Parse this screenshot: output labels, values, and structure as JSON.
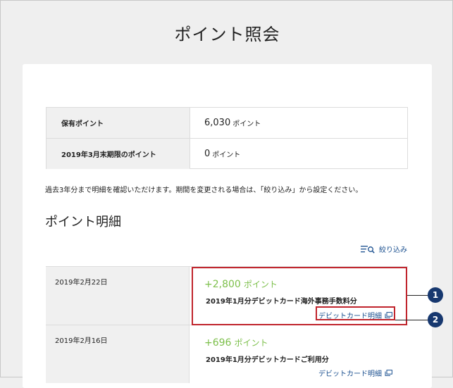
{
  "page": {
    "title": "ポイント照会"
  },
  "summary": {
    "rows": [
      {
        "label": "保有ポイント",
        "value": "6,030",
        "unit": "ポイント"
      },
      {
        "label": "2019年3月末期限のポイント",
        "value": "0",
        "unit": "ポイント"
      }
    ]
  },
  "note": "過去3年分まで明細を確認いただけます。期間を変更される場合は、「絞り込み」から設定ください。",
  "detail": {
    "title": "ポイント明細",
    "filter_label": "絞り込み",
    "rows": [
      {
        "date": "2019年2月22日",
        "points": "+2,800",
        "unit": "ポイント",
        "description": "2019年1月分デビットカード海外事務手数料分",
        "link": "デビットカード明細"
      },
      {
        "date": "2019年2月16日",
        "points": "+696",
        "unit": "ポイント",
        "description": "2019年1月分デビットカードご利用分",
        "link": "デビットカード明細"
      }
    ]
  },
  "callouts": [
    "1",
    "2"
  ],
  "colors": {
    "points_green": "#7cbf4a",
    "link_blue": "#1a4f8f",
    "highlight_red": "#c0242c",
    "callout_navy": "#17386f"
  }
}
